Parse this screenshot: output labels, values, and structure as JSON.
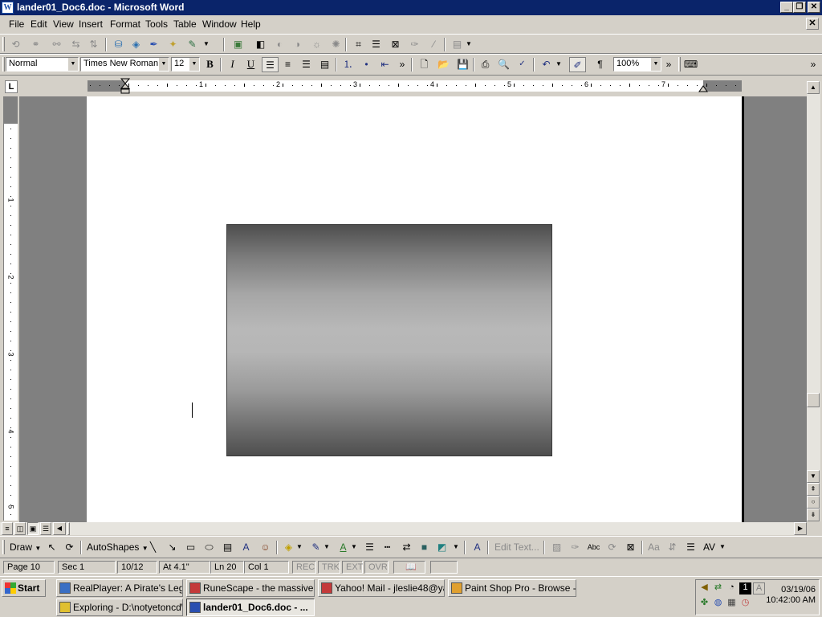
{
  "window": {
    "title": "lander01_Doc6.doc - Microsoft Word",
    "app_icon": "word-doc-icon",
    "minimize_glyph": "_",
    "restore_glyph": "❐",
    "close_glyph": "✕",
    "doc_close_glyph": "✕"
  },
  "menu": {
    "items": [
      {
        "label": "File"
      },
      {
        "label": "Edit"
      },
      {
        "label": "View"
      },
      {
        "label": "Insert"
      },
      {
        "label": "Format"
      },
      {
        "label": "Tools"
      },
      {
        "label": "Table"
      },
      {
        "label": "Window"
      },
      {
        "label": "Help"
      }
    ]
  },
  "format_bar": {
    "style": "Normal",
    "font": "Times New Roman",
    "size": "12",
    "bold": "B",
    "italic": "I",
    "underline": "U",
    "paragraph_mark": "¶",
    "zoom": "100%",
    "overflow": "»"
  },
  "ruler": {
    "numbers": [
      "1",
      "2",
      "3",
      "4",
      "5",
      "6",
      "7"
    ],
    "tab_selector": "L"
  },
  "vruler": {
    "numbers": [
      "1",
      "2",
      "3",
      "4",
      "5"
    ]
  },
  "drawing_toolbar": {
    "draw": "Draw",
    "autoshapes": "AutoShapes",
    "edit_text": "Edit Text..."
  },
  "status": {
    "page": "Page 10",
    "sec": "Sec 1",
    "pages": "10/12",
    "at": "At  4.1\"",
    "ln": "Ln 20",
    "col": "Col 1",
    "rec": "REC",
    "trk": "TRK",
    "ext": "EXT",
    "ovr": "OVR"
  },
  "taskbar": {
    "start": "Start",
    "tasks_row1": [
      {
        "label": "RealPlayer: A Pirate's Leg...",
        "icon": "realplayer-icon",
        "color": "#3a6fc4"
      },
      {
        "label": "RuneScape - the massive ...",
        "icon": "browser-icon",
        "color": "#c43a3a"
      },
      {
        "label": "Yahoo! Mail - jleslie48@ya...",
        "icon": "browser-icon",
        "color": "#c43a3a"
      },
      {
        "label": "Paint Shop Pro - Browse - ...",
        "icon": "paintshop-icon",
        "color": "#e0a030"
      }
    ],
    "tasks_row2": [
      {
        "label": "Exploring - D:\\notyetoncd\\...",
        "icon": "explorer-icon",
        "color": "#e0c030"
      },
      {
        "label": "lander01_Doc6.doc - ...",
        "icon": "word-doc-icon",
        "color": "#2a4fb0"
      }
    ],
    "clock_date": "03/19/06",
    "clock_time": "10:42:00 AM",
    "tray_num": "1",
    "tray_letter": "A"
  },
  "colors": {
    "titlebar": "#0a246a",
    "chrome": "#d4d0c8",
    "doc_bg": "#808080",
    "page": "#ffffff"
  }
}
